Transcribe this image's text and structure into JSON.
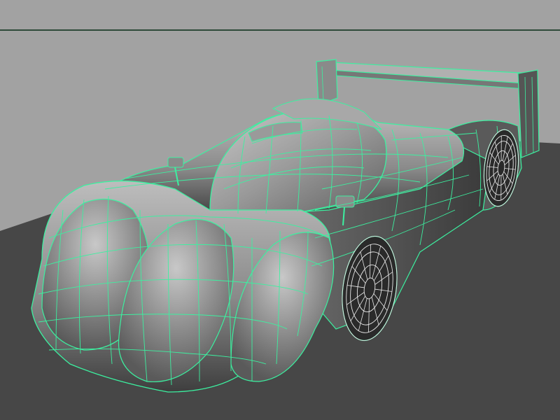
{
  "viewport": {
    "colors": {
      "background": "#a2a2a2",
      "floor": "#474747",
      "frame_line": "#2e4a3a",
      "wire_selected": "#3cf0a0",
      "wire_wheel": "#e8e8e8",
      "body_light": "#bdbdbd",
      "body_mid": "#8a8a8a",
      "body_dark": "#3e3e3e"
    },
    "object": {
      "type": "polygon-mesh",
      "description_icon": "race-car-model",
      "display_mode": "smooth-shaded-with-wireframe",
      "selected": true
    }
  }
}
